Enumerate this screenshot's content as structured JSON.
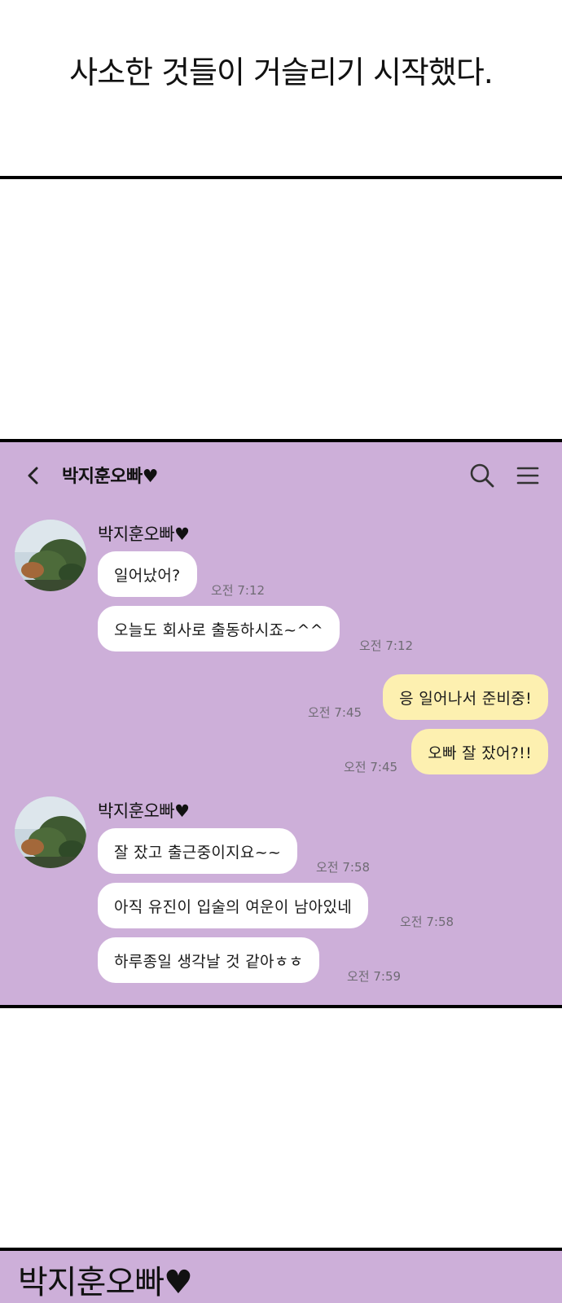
{
  "caption": "사소한 것들이 거슬리기 시작했다.",
  "chat": {
    "title": "박지훈오빠♥",
    "groups": [
      {
        "sender": "박지훈오빠♥",
        "messages": [
          {
            "text": "일어났어?",
            "time": "오전 7:12"
          },
          {
            "text": "오늘도 회사로 출동하시죠~^^",
            "time": "오전 7:12"
          }
        ]
      },
      {
        "outgoing": [
          {
            "text": "응 일어나서 준비중!",
            "time": "오전 7:45"
          },
          {
            "text": "오빠 잘 잤어?!!",
            "time": "오전 7:45"
          }
        ]
      },
      {
        "sender": "박지훈오빠♥",
        "messages": [
          {
            "text": "잘 잤고 출근중이지요~~",
            "time": "오전 7:58"
          },
          {
            "text": "아직 유진이 입술의 여운이 남아있네",
            "time": "오전 7:58"
          },
          {
            "text": "하루종일 생각날 것 같아ㅎㅎ",
            "time": "오전 7:59"
          }
        ]
      }
    ]
  },
  "bottom_label": "박지훈오빠♥",
  "colors": {
    "panel_bg": "#cdafd9",
    "incoming_bubble": "#ffffff",
    "outgoing_bubble": "#fdf0b0",
    "timestamp": "#6f6b74"
  },
  "icons": [
    "back-chevron-icon",
    "search-icon",
    "menu-icon"
  ]
}
